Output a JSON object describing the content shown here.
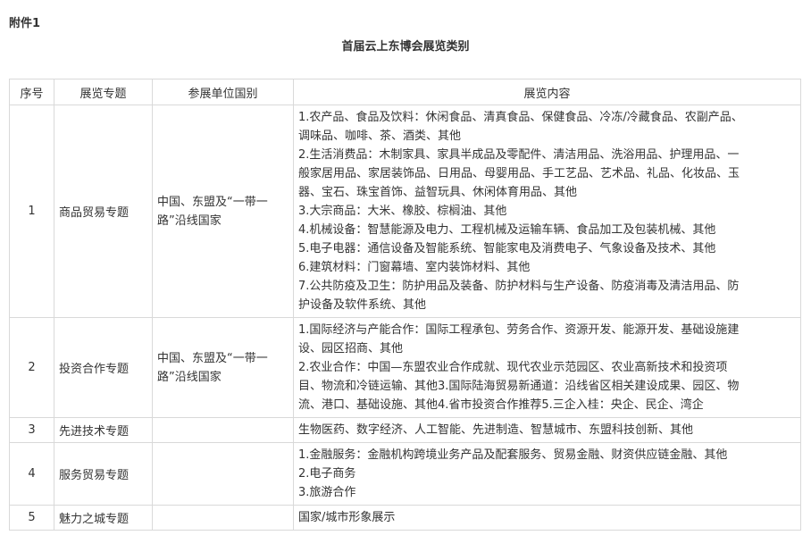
{
  "attachment_label": "附件1",
  "title": "首届云上东博会展览类别",
  "columns": {
    "no": "序号",
    "topic": "展览专题",
    "countries": "参展单位国别",
    "content": "展览内容"
  },
  "rows": [
    {
      "no": "1",
      "topic": "商品贸易专题",
      "countries": "中国、东盟及“一带一路”沿线国家",
      "content": [
        "1.农产品、食品及饮料：休闲食品、清真食品、保健食品、冷冻/冷藏食品、农副产品、",
        "调味品、咖啡、茶、酒类、其他",
        "2.生活消费品：木制家具、家具半成品及零配件、清洁用品、洗浴用品、护理用品、一",
        "般家居用品、家居装饰品、日用品、母婴用品、手工艺品、艺术品、礼品、化妆品、玉",
        "器、宝石、珠宝首饰、益智玩具、休闲体育用品、其他",
        "3.大宗商品：大米、橡胶、棕榈油、其他",
        "4.机械设备：智慧能源及电力、工程机械及运输车辆、食品加工及包装机械、其他",
        "5.电子电器：通信设备及智能系统、智能家电及消费电子、气象设备及技术、其他",
        "6.建筑材料：门窗幕墙、室内装饰材料、其他",
        "7.公共防疫及卫生：防护用品及装备、防护材料与生产设备、防疫消毒及清洁用品、防",
        "护设备及软件系统、其他"
      ]
    },
    {
      "no": "2",
      "topic": "投资合作专题",
      "countries": "中国、东盟及“一带一路”沿线国家",
      "content": [
        "1.国际经济与产能合作：国际工程承包、劳务合作、资源开发、能源开发、基础设施建",
        "设、园区招商、其他",
        "2.农业合作：中国—东盟农业合作成就、现代农业示范园区、农业高新技术和投资项",
        "目、物流和冷链运输、其他3.国际陆海贸易新通道：沿线省区相关建设成果、园区、物",
        "流、港口、基础设施、其他4.省市投资合作推荐5.三企入桂：央企、民企、湾企"
      ]
    },
    {
      "no": "3",
      "topic": "先进技术专题",
      "countries": "",
      "content": [
        "生物医药、数字经济、人工智能、先进制造、智慧城市、东盟科技创新、其他"
      ]
    },
    {
      "no": "4",
      "topic": "服务贸易专题",
      "countries": "",
      "content": [
        "1.金融服务：金融机构跨境业务产品及配套服务、贸易金融、财资供应链金融、其他",
        "2.电子商务",
        "3.旅游合作"
      ]
    },
    {
      "no": "5",
      "topic": "魅力之城专题",
      "countries": "",
      "content": [
        "国家/城市形象展示"
      ]
    }
  ]
}
